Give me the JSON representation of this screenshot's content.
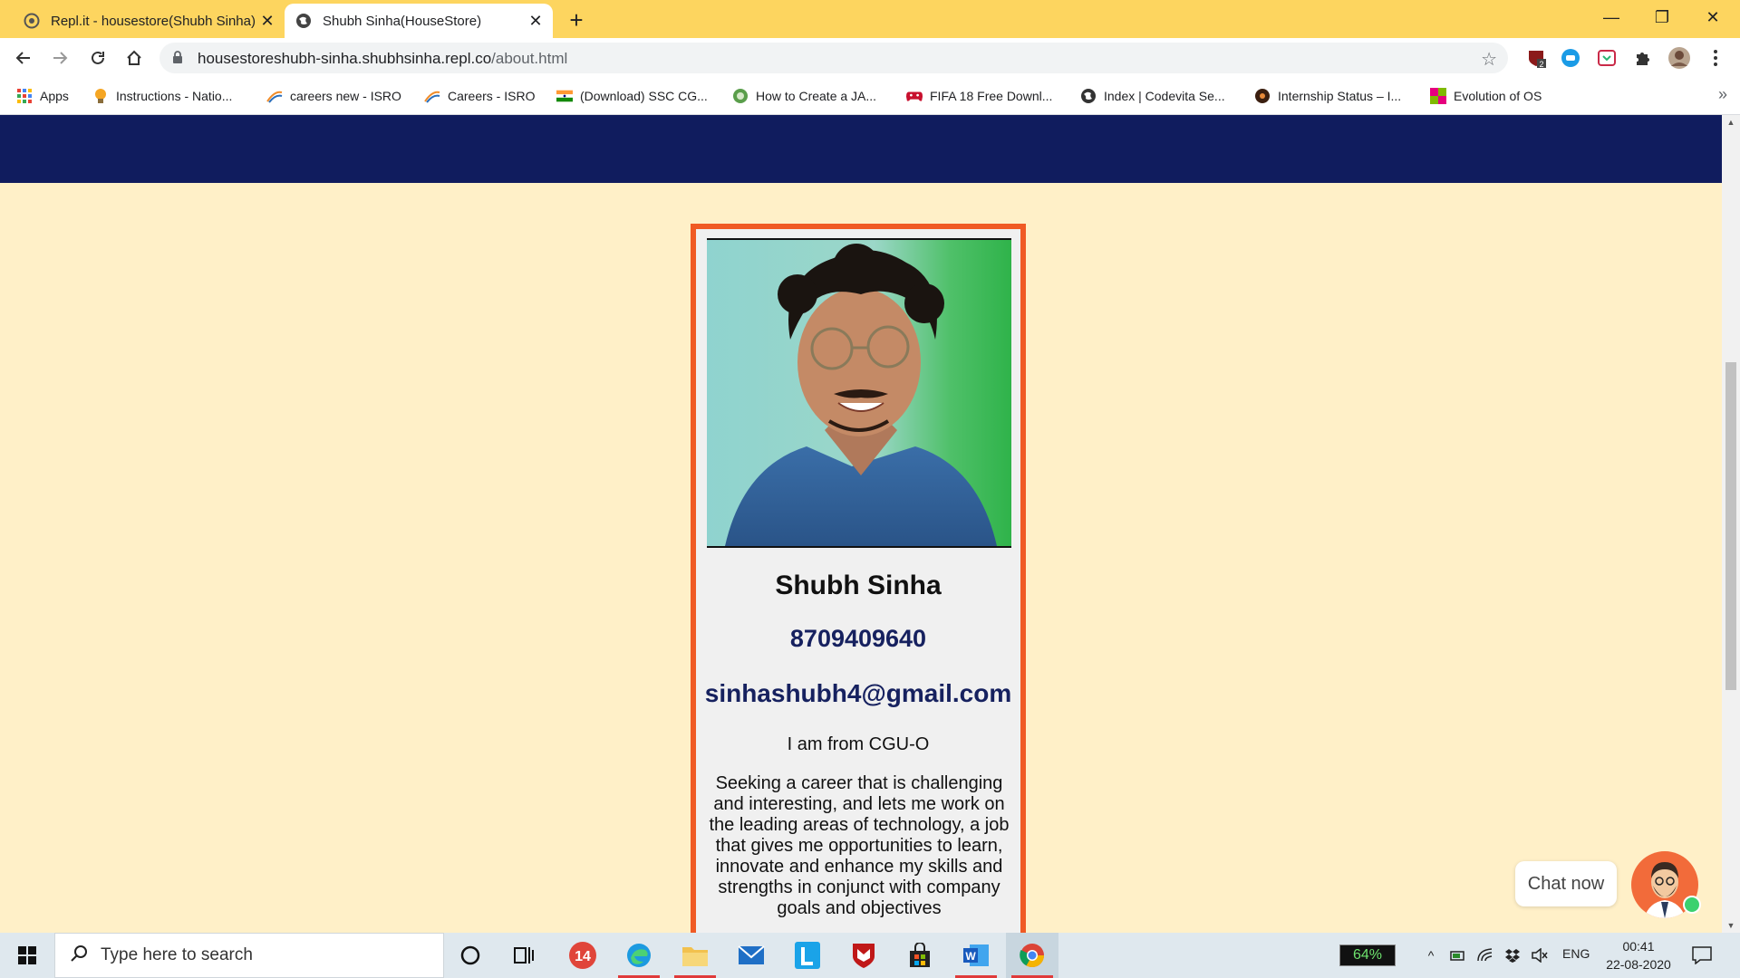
{
  "browser": {
    "tabs": [
      {
        "title": "Repl.it - housestore(Shubh Sinha)",
        "active": false
      },
      {
        "title": "Shubh Sinha(HouseStore)",
        "active": true
      }
    ],
    "new_tab": "+",
    "window_controls": {
      "minimize": "—",
      "restore": "❐",
      "close": "✕"
    },
    "url_host": "housestoreshubh-sinha.shubhsinha.repl.co",
    "url_path": "/about.html",
    "extensions": {
      "badge_count": "2"
    },
    "bookmarks": [
      "Apps",
      "Instructions - Natio...",
      "careers new - ISRO",
      "Careers - ISRO",
      "(Download) SSC CG...",
      "How to Create a JA...",
      "FIFA 18 Free Downl...",
      "Index | Codevita Se...",
      "Internship Status – I...",
      "Evolution of OS"
    ],
    "bookmarks_more": "»"
  },
  "page": {
    "nav_color": "#101c5e",
    "background": "#fff0c8",
    "card_border": "#f05a24",
    "profile": {
      "name": "Shubh Sinha",
      "phone": "8709409640",
      "email": "sinhashubh4@gmail.com",
      "origin": "I am from CGU-O",
      "bio": "Seeking a career that is challenging and interesting, and lets me work on the leading areas of technology, a job that gives me opportunities to learn, innovate and enhance my skills and strengths in conjunct with company goals and objectives"
    },
    "chat": {
      "label": "Chat now"
    }
  },
  "taskbar": {
    "search_placeholder": "Type here to search",
    "calendar_badge": "14",
    "battery": "64%",
    "language": "ENG",
    "time": "00:41",
    "date": "22-08-2020"
  }
}
